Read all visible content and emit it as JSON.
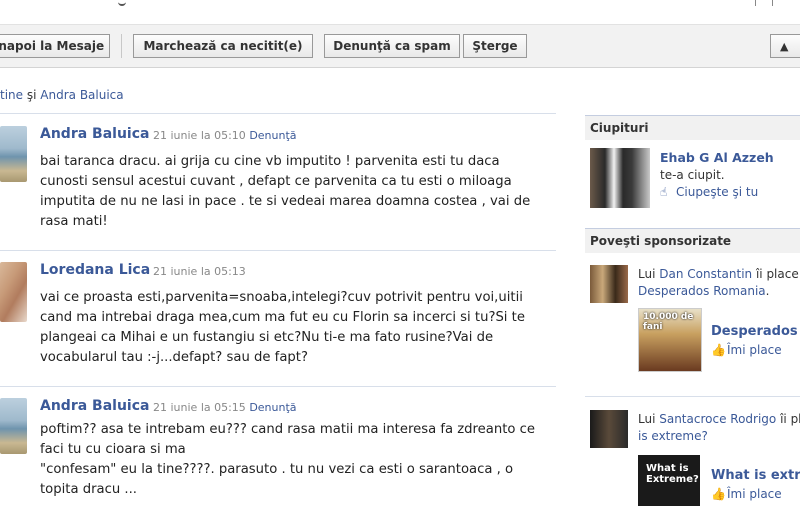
{
  "toolbar": {
    "back_label": "Înapoi la Mesaje",
    "mark_unread_label": "Marchează ca necitit(e)",
    "report_spam_label": "Denunţă ca spam",
    "delete_label": "Şterge"
  },
  "participants": {
    "first": "tine",
    "and": "şi",
    "second": "Andra Baluica"
  },
  "messages": [
    {
      "author": "Andra Baluica",
      "date": "21 iunie la 05:10",
      "report": "Denunţă",
      "text": "bai taranca dracu. ai grija cu cine vb imputito ! parvenita esti tu daca cunosti sensul acestui cuvant , defapt ce parvenita ca tu esti o miloaga imputita de nu ne lasi in pace . te si vedeai marea doamna costea , vai de rasa mati!"
    },
    {
      "author": "Loredana Lica",
      "date": "21 iunie la 05:13",
      "report": "",
      "text": "vai ce proasta esti,parvenita=snoaba,intelegi?cuv potrivit pentru voi,uitii cand ma intrebai draga mea,cum ma fut eu cu Florin sa incerci si tu?Si te plangeai ca Mihai e un fustangiu si etc?Nu ti-e ma fato rusine?Vai de vocabularul tau :-j...defapt? sau de fapt?"
    },
    {
      "author": "Andra Baluica",
      "date": "21 iunie la 05:15",
      "report": "Denunţă",
      "text": "poftim?? asa te intrebam eu??? cand rasa matii ma interesa fa zdreanto ce faci tu cu cioara si ma\n\"confesam\" eu la tine????. parasuto . tu nu vezi ca esti o sarantoaca , o topita dracu ..."
    }
  ],
  "sidebar": {
    "pokes_header": "Ciupituri",
    "poke_name": "Ehab G Al Azzeh",
    "poke_text": "te-a ciupit.",
    "poke_back": "Ciupeşte şi tu",
    "sponsored_header": "Poveşti sponsorizate",
    "ads": [
      {
        "prefix": "Lui ",
        "person": "Dan Constantin",
        "likes": " îi place",
        "page": "Desperados Romania",
        "tail": ".",
        "title": "Desperados R",
        "like_label": "Îmi place",
        "img_caption": "10.000 de fani"
      },
      {
        "prefix": "Lui ",
        "person": "Santacroce Rodrigo",
        "likes": " îi pla",
        "page": "is extreme?",
        "tail": "",
        "title": "What is extr",
        "like_label": "Îmi place",
        "img_caption": "What is Extreme?"
      }
    ]
  }
}
